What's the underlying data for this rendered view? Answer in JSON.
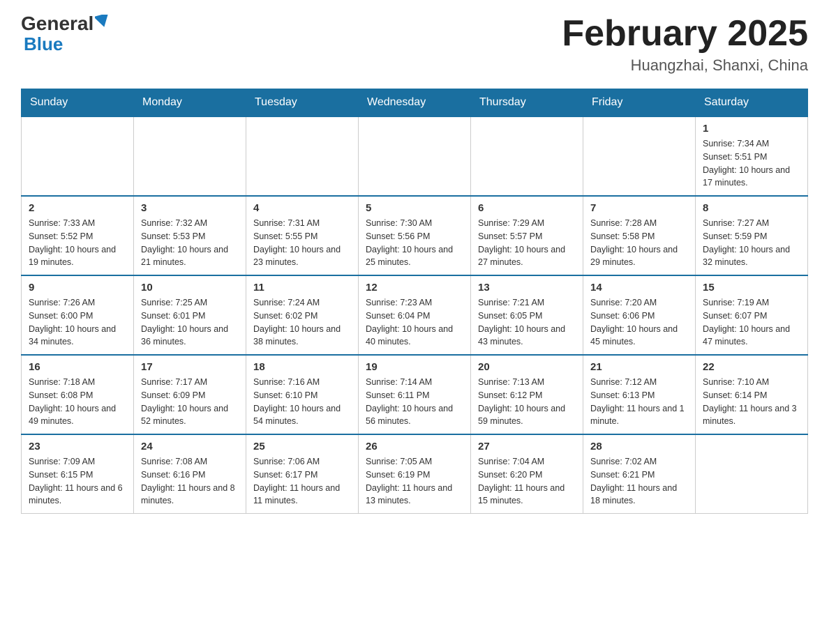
{
  "header": {
    "logo_general": "General",
    "logo_blue": "Blue",
    "month_title": "February 2025",
    "location": "Huangzhai, Shanxi, China"
  },
  "weekdays": [
    "Sunday",
    "Monday",
    "Tuesday",
    "Wednesday",
    "Thursday",
    "Friday",
    "Saturday"
  ],
  "weeks": [
    [
      {
        "day": "",
        "info": ""
      },
      {
        "day": "",
        "info": ""
      },
      {
        "day": "",
        "info": ""
      },
      {
        "day": "",
        "info": ""
      },
      {
        "day": "",
        "info": ""
      },
      {
        "day": "",
        "info": ""
      },
      {
        "day": "1",
        "info": "Sunrise: 7:34 AM\nSunset: 5:51 PM\nDaylight: 10 hours and 17 minutes."
      }
    ],
    [
      {
        "day": "2",
        "info": "Sunrise: 7:33 AM\nSunset: 5:52 PM\nDaylight: 10 hours and 19 minutes."
      },
      {
        "day": "3",
        "info": "Sunrise: 7:32 AM\nSunset: 5:53 PM\nDaylight: 10 hours and 21 minutes."
      },
      {
        "day": "4",
        "info": "Sunrise: 7:31 AM\nSunset: 5:55 PM\nDaylight: 10 hours and 23 minutes."
      },
      {
        "day": "5",
        "info": "Sunrise: 7:30 AM\nSunset: 5:56 PM\nDaylight: 10 hours and 25 minutes."
      },
      {
        "day": "6",
        "info": "Sunrise: 7:29 AM\nSunset: 5:57 PM\nDaylight: 10 hours and 27 minutes."
      },
      {
        "day": "7",
        "info": "Sunrise: 7:28 AM\nSunset: 5:58 PM\nDaylight: 10 hours and 29 minutes."
      },
      {
        "day": "8",
        "info": "Sunrise: 7:27 AM\nSunset: 5:59 PM\nDaylight: 10 hours and 32 minutes."
      }
    ],
    [
      {
        "day": "9",
        "info": "Sunrise: 7:26 AM\nSunset: 6:00 PM\nDaylight: 10 hours and 34 minutes."
      },
      {
        "day": "10",
        "info": "Sunrise: 7:25 AM\nSunset: 6:01 PM\nDaylight: 10 hours and 36 minutes."
      },
      {
        "day": "11",
        "info": "Sunrise: 7:24 AM\nSunset: 6:02 PM\nDaylight: 10 hours and 38 minutes."
      },
      {
        "day": "12",
        "info": "Sunrise: 7:23 AM\nSunset: 6:04 PM\nDaylight: 10 hours and 40 minutes."
      },
      {
        "day": "13",
        "info": "Sunrise: 7:21 AM\nSunset: 6:05 PM\nDaylight: 10 hours and 43 minutes."
      },
      {
        "day": "14",
        "info": "Sunrise: 7:20 AM\nSunset: 6:06 PM\nDaylight: 10 hours and 45 minutes."
      },
      {
        "day": "15",
        "info": "Sunrise: 7:19 AM\nSunset: 6:07 PM\nDaylight: 10 hours and 47 minutes."
      }
    ],
    [
      {
        "day": "16",
        "info": "Sunrise: 7:18 AM\nSunset: 6:08 PM\nDaylight: 10 hours and 49 minutes."
      },
      {
        "day": "17",
        "info": "Sunrise: 7:17 AM\nSunset: 6:09 PM\nDaylight: 10 hours and 52 minutes."
      },
      {
        "day": "18",
        "info": "Sunrise: 7:16 AM\nSunset: 6:10 PM\nDaylight: 10 hours and 54 minutes."
      },
      {
        "day": "19",
        "info": "Sunrise: 7:14 AM\nSunset: 6:11 PM\nDaylight: 10 hours and 56 minutes."
      },
      {
        "day": "20",
        "info": "Sunrise: 7:13 AM\nSunset: 6:12 PM\nDaylight: 10 hours and 59 minutes."
      },
      {
        "day": "21",
        "info": "Sunrise: 7:12 AM\nSunset: 6:13 PM\nDaylight: 11 hours and 1 minute."
      },
      {
        "day": "22",
        "info": "Sunrise: 7:10 AM\nSunset: 6:14 PM\nDaylight: 11 hours and 3 minutes."
      }
    ],
    [
      {
        "day": "23",
        "info": "Sunrise: 7:09 AM\nSunset: 6:15 PM\nDaylight: 11 hours and 6 minutes."
      },
      {
        "day": "24",
        "info": "Sunrise: 7:08 AM\nSunset: 6:16 PM\nDaylight: 11 hours and 8 minutes."
      },
      {
        "day": "25",
        "info": "Sunrise: 7:06 AM\nSunset: 6:17 PM\nDaylight: 11 hours and 11 minutes."
      },
      {
        "day": "26",
        "info": "Sunrise: 7:05 AM\nSunset: 6:19 PM\nDaylight: 11 hours and 13 minutes."
      },
      {
        "day": "27",
        "info": "Sunrise: 7:04 AM\nSunset: 6:20 PM\nDaylight: 11 hours and 15 minutes."
      },
      {
        "day": "28",
        "info": "Sunrise: 7:02 AM\nSunset: 6:21 PM\nDaylight: 11 hours and 18 minutes."
      },
      {
        "day": "",
        "info": ""
      }
    ]
  ]
}
